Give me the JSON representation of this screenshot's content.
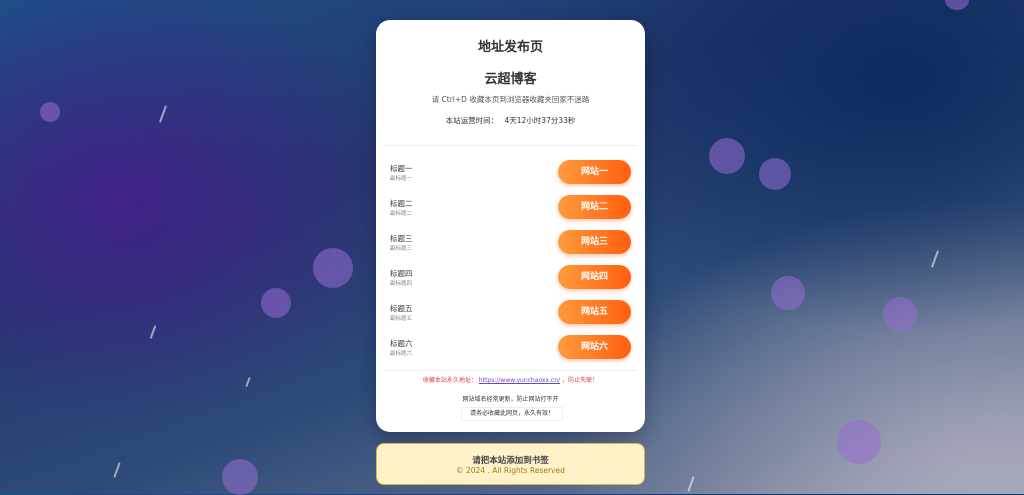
{
  "header": {
    "page_title": "地址发布页",
    "site_name": "云超博客",
    "bookmark_hint": "请 Ctrl+D 收藏本页到浏览器收藏夹回家不迷路",
    "runtime_label": "本站运营时间：",
    "runtime_value": "4天12小时37分33秒"
  },
  "links": [
    {
      "title": "标题一",
      "subtitle": "副标题一",
      "button": "网站一"
    },
    {
      "title": "标题二",
      "subtitle": "副标题二",
      "button": "网站二"
    },
    {
      "title": "标题三",
      "subtitle": "副标题三",
      "button": "网站三"
    },
    {
      "title": "标题四",
      "subtitle": "副标题四",
      "button": "网站四"
    },
    {
      "title": "标题五",
      "subtitle": "副标题五",
      "button": "网站五"
    },
    {
      "title": "标题六",
      "subtitle": "副标题六",
      "button": "网站六"
    }
  ],
  "permanent": {
    "prefix": "收藏本站永久地址：",
    "url": "https://www.yunchaoxx.cn/",
    "suffix": "，防止失联！"
  },
  "notes": {
    "line1": "网站域名经常更新，防止网站打不开",
    "line2": "请务必收藏此网页，永久有效！"
  },
  "footer": {
    "bookmark_text": "请把本站添加到书签",
    "copyright": "© 2024 . All Rights Reserved"
  },
  "colors": {
    "button_gradient_start": "#ff9a3c",
    "button_gradient_end": "#ff5f10",
    "perm_text": "#e0413d",
    "link": "#6a46c2",
    "footer_bg": "#fff1c8",
    "footer_border": "#d8b24f"
  }
}
